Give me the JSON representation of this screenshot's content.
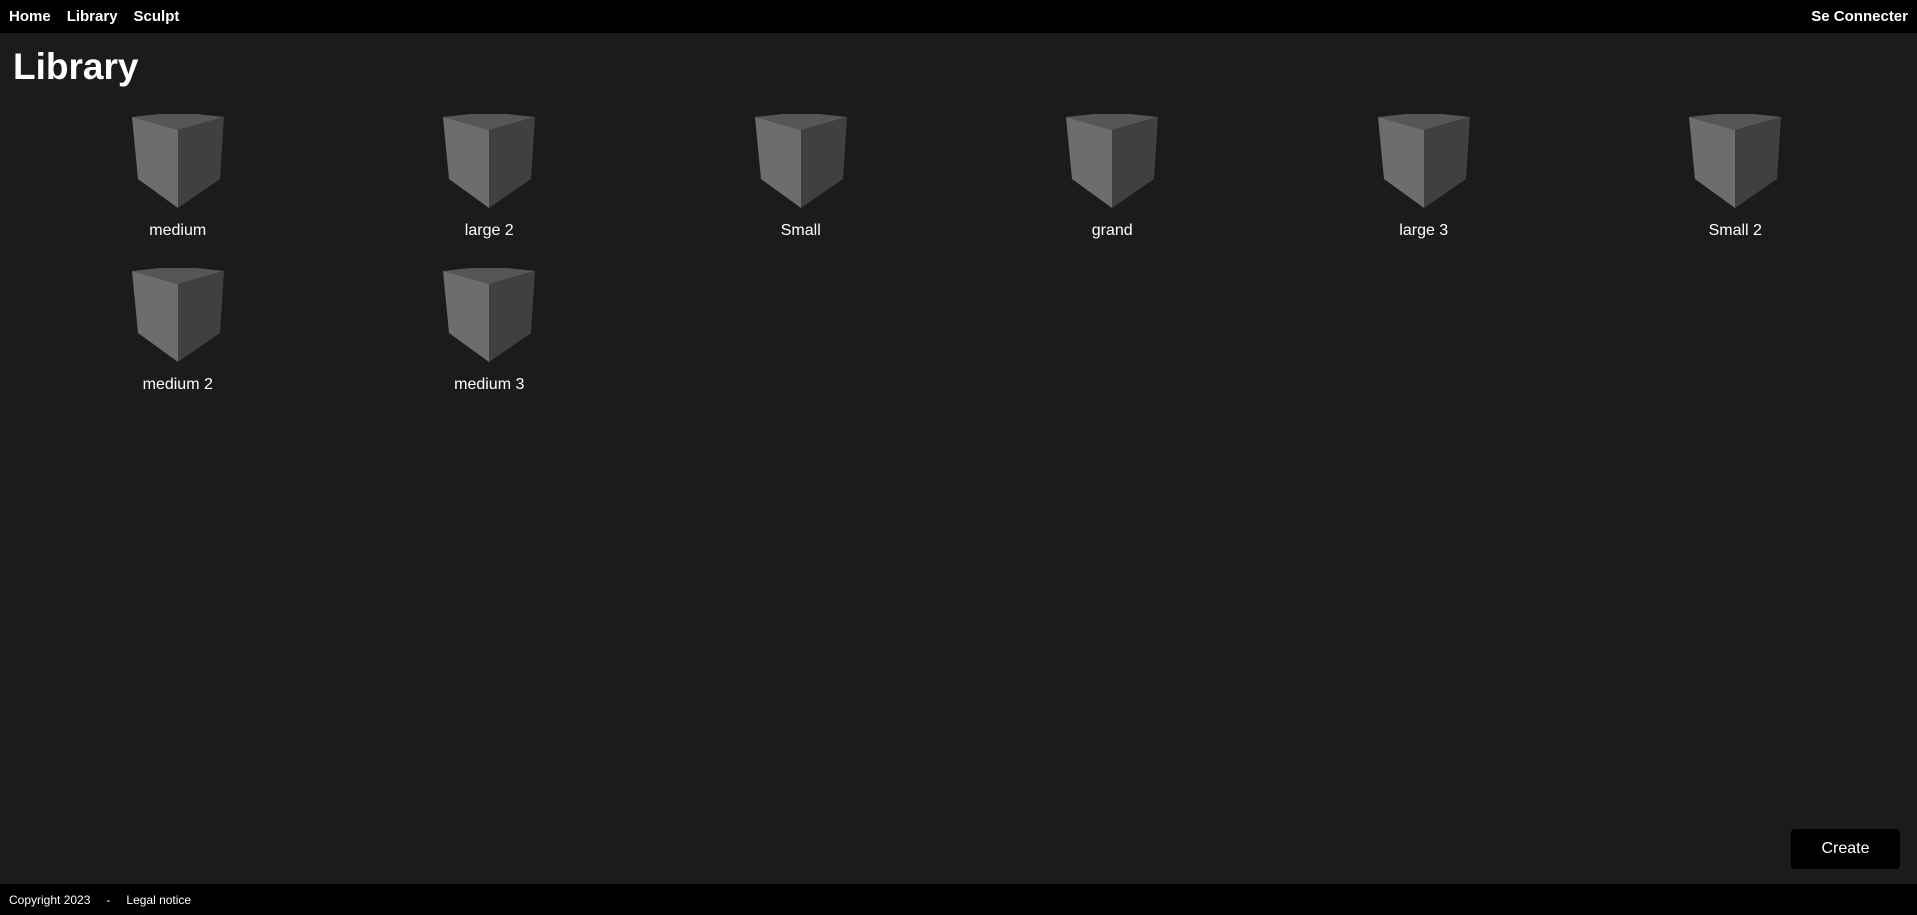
{
  "nav": {
    "items": [
      {
        "label": "Home"
      },
      {
        "label": "Library"
      },
      {
        "label": "Sculpt"
      }
    ],
    "login_label": "Se Connecter"
  },
  "page": {
    "title": "Library"
  },
  "library": {
    "models": [
      {
        "name": "medium",
        "icon": "cube-icon"
      },
      {
        "name": "large 2",
        "icon": "cube-icon"
      },
      {
        "name": "Small",
        "icon": "cube-icon"
      },
      {
        "name": "grand",
        "icon": "cube-icon"
      },
      {
        "name": "large 3",
        "icon": "cube-icon"
      },
      {
        "name": "Small 2",
        "icon": "cube-icon"
      },
      {
        "name": "medium 2",
        "icon": "cube-icon"
      },
      {
        "name": "medium 3",
        "icon": "cube-icon"
      }
    ]
  },
  "actions": {
    "create_label": "Create"
  },
  "footer": {
    "copyright": "Copyright 2023",
    "separator": "-",
    "legal_label": "Legal notice"
  },
  "colors": {
    "background": "#1b1b1d",
    "bar": "#000000",
    "cube_top": "#565656",
    "cube_left": "#6d6d6d",
    "cube_right": "#404040"
  }
}
